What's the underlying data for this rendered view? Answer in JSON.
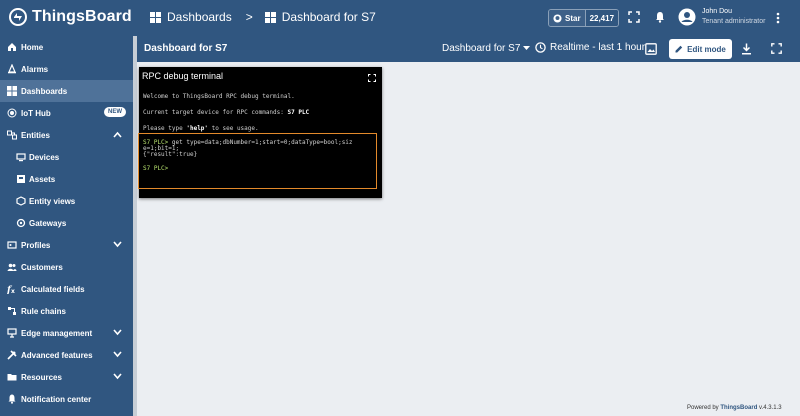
{
  "topbar": {
    "logo_text": "ThingsBoard",
    "breadcrumb": [
      "Dashboards",
      "Dashboard for S7"
    ],
    "breadcrumb_sep": ">",
    "github_star_label": "Star",
    "github_star_count": "22,417",
    "user_name": "John Dou",
    "user_role": "Tenant administrator"
  },
  "sidebar": {
    "items": [
      {
        "label": "Home"
      },
      {
        "label": "Alarms"
      },
      {
        "label": "Dashboards"
      },
      {
        "label": "IoT Hub",
        "badge": "NEW"
      },
      {
        "label": "Entities"
      },
      {
        "label": "Devices"
      },
      {
        "label": "Assets"
      },
      {
        "label": "Entity views"
      },
      {
        "label": "Gateways"
      },
      {
        "label": "Profiles"
      },
      {
        "label": "Customers"
      },
      {
        "label": "Calculated fields"
      },
      {
        "label": "Rule chains"
      },
      {
        "label": "Edge management"
      },
      {
        "label": "Advanced features"
      },
      {
        "label": "Resources"
      },
      {
        "label": "Notification center"
      }
    ]
  },
  "dashbar": {
    "title": "Dashboard for S7",
    "state_select": "Dashboard for S7",
    "timewindow": "Realtime - last 1 hour",
    "edit_label": "Edit mode"
  },
  "widget": {
    "title": "RPC debug terminal",
    "welcome": "Welcome to ThingsBoard RPC debug terminal.",
    "target_prefix": "Current target device for RPC commands: ",
    "target_device": "S7 PLC",
    "help_prefix": "Please type ",
    "help_word": "'help'",
    "help_suffix": " to see usage.",
    "prompt": "S7 PLC>",
    "command_line1": " get type=data;dbNumber=1;start=0;dataType=bool;siz",
    "command_line2": "e=1;bit=1;",
    "result": "{\"result\":true}"
  },
  "footer": {
    "powered_prefix": "Powered by ",
    "powered_brand": "ThingsBoard",
    "version": " v.4.3.1.3"
  },
  "colors": {
    "primary": "#305680",
    "active": "#4f7299",
    "terminal_border": "#e38a2b",
    "prompt": "#b7e26e"
  }
}
